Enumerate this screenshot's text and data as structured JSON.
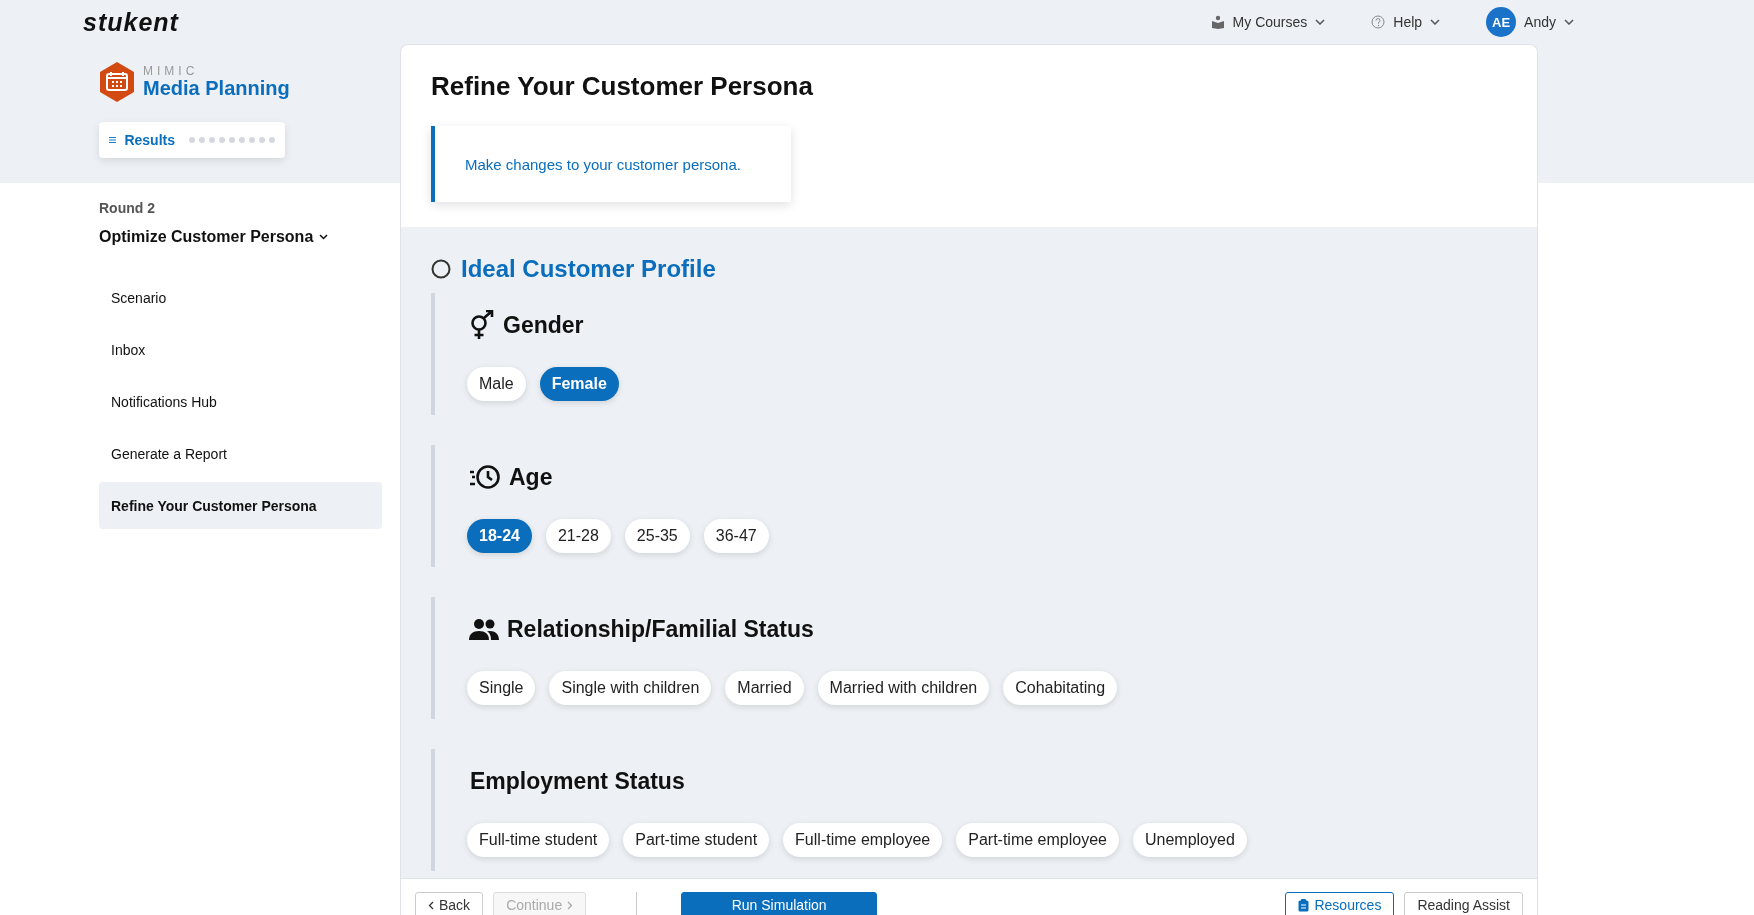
{
  "header": {
    "logo": "stukent",
    "nav": [
      {
        "kind": "courses",
        "label": "My Courses"
      },
      {
        "kind": "help",
        "label": "Help"
      },
      {
        "kind": "user",
        "initials": "AE",
        "label": "Andy"
      }
    ]
  },
  "app": {
    "brand": "MIMIC",
    "title": "Media Planning"
  },
  "results": {
    "label": "Results",
    "steps": [
      {
        "completed": false
      },
      {
        "completed": false
      },
      {
        "completed": false
      },
      {
        "completed": false
      },
      {
        "completed": false
      },
      {
        "completed": false
      },
      {
        "completed": false
      },
      {
        "completed": false
      },
      {
        "completed": false
      }
    ]
  },
  "sidebar": {
    "round": "Round 2",
    "module": "Optimize Customer Persona",
    "expanded": true,
    "items": [
      {
        "label": "Scenario",
        "selected": false
      },
      {
        "label": "Inbox",
        "selected": false
      },
      {
        "label": "Notifications Hub",
        "selected": false
      },
      {
        "label": "Generate a Report",
        "selected": false
      },
      {
        "label": "Refine Your Customer Persona",
        "selected": true
      }
    ]
  },
  "page": {
    "title": "Refine Your Customer Persona",
    "callout": "Make changes to your customer persona."
  },
  "profile": {
    "title": "Ideal Customer Profile",
    "complete": false,
    "groups": [
      {
        "kind": "gender",
        "title": "Gender",
        "options": [
          {
            "label": "Male",
            "selected": false
          },
          {
            "label": "Female",
            "selected": true
          }
        ]
      },
      {
        "kind": "age",
        "title": "Age",
        "options": [
          {
            "label": "18-24",
            "selected": true
          },
          {
            "label": "21-28",
            "selected": false
          },
          {
            "label": "25-35",
            "selected": false
          },
          {
            "label": "36-47",
            "selected": false
          }
        ]
      },
      {
        "kind": "relationship",
        "title": "Relationship/Familial Status",
        "options": [
          {
            "label": "Single",
            "selected": false
          },
          {
            "label": "Single with children",
            "selected": false
          },
          {
            "label": "Married",
            "selected": false
          },
          {
            "label": "Married with children",
            "selected": false
          },
          {
            "label": "Cohabitating",
            "selected": false
          }
        ]
      },
      {
        "kind": "employment",
        "title": "Employment Status",
        "options": [
          {
            "label": "Full-time student",
            "selected": false
          },
          {
            "label": "Part-time student",
            "selected": false
          },
          {
            "label": "Full-time employee",
            "selected": false
          },
          {
            "label": "Part-time employee",
            "selected": false
          },
          {
            "label": "Unemployed",
            "selected": false
          }
        ]
      }
    ]
  },
  "footer": {
    "buttons": [
      {
        "kind": "back",
        "label": "Back",
        "disabled": false
      },
      {
        "kind": "continue",
        "label": "Continue",
        "disabled": true
      },
      {
        "kind": "primary",
        "label": "Run Simulation",
        "disabled": false
      },
      {
        "kind": "resources",
        "label": "Resources",
        "disabled": false
      },
      {
        "kind": "plain",
        "label": "Reading Assist",
        "disabled": false
      }
    ]
  }
}
